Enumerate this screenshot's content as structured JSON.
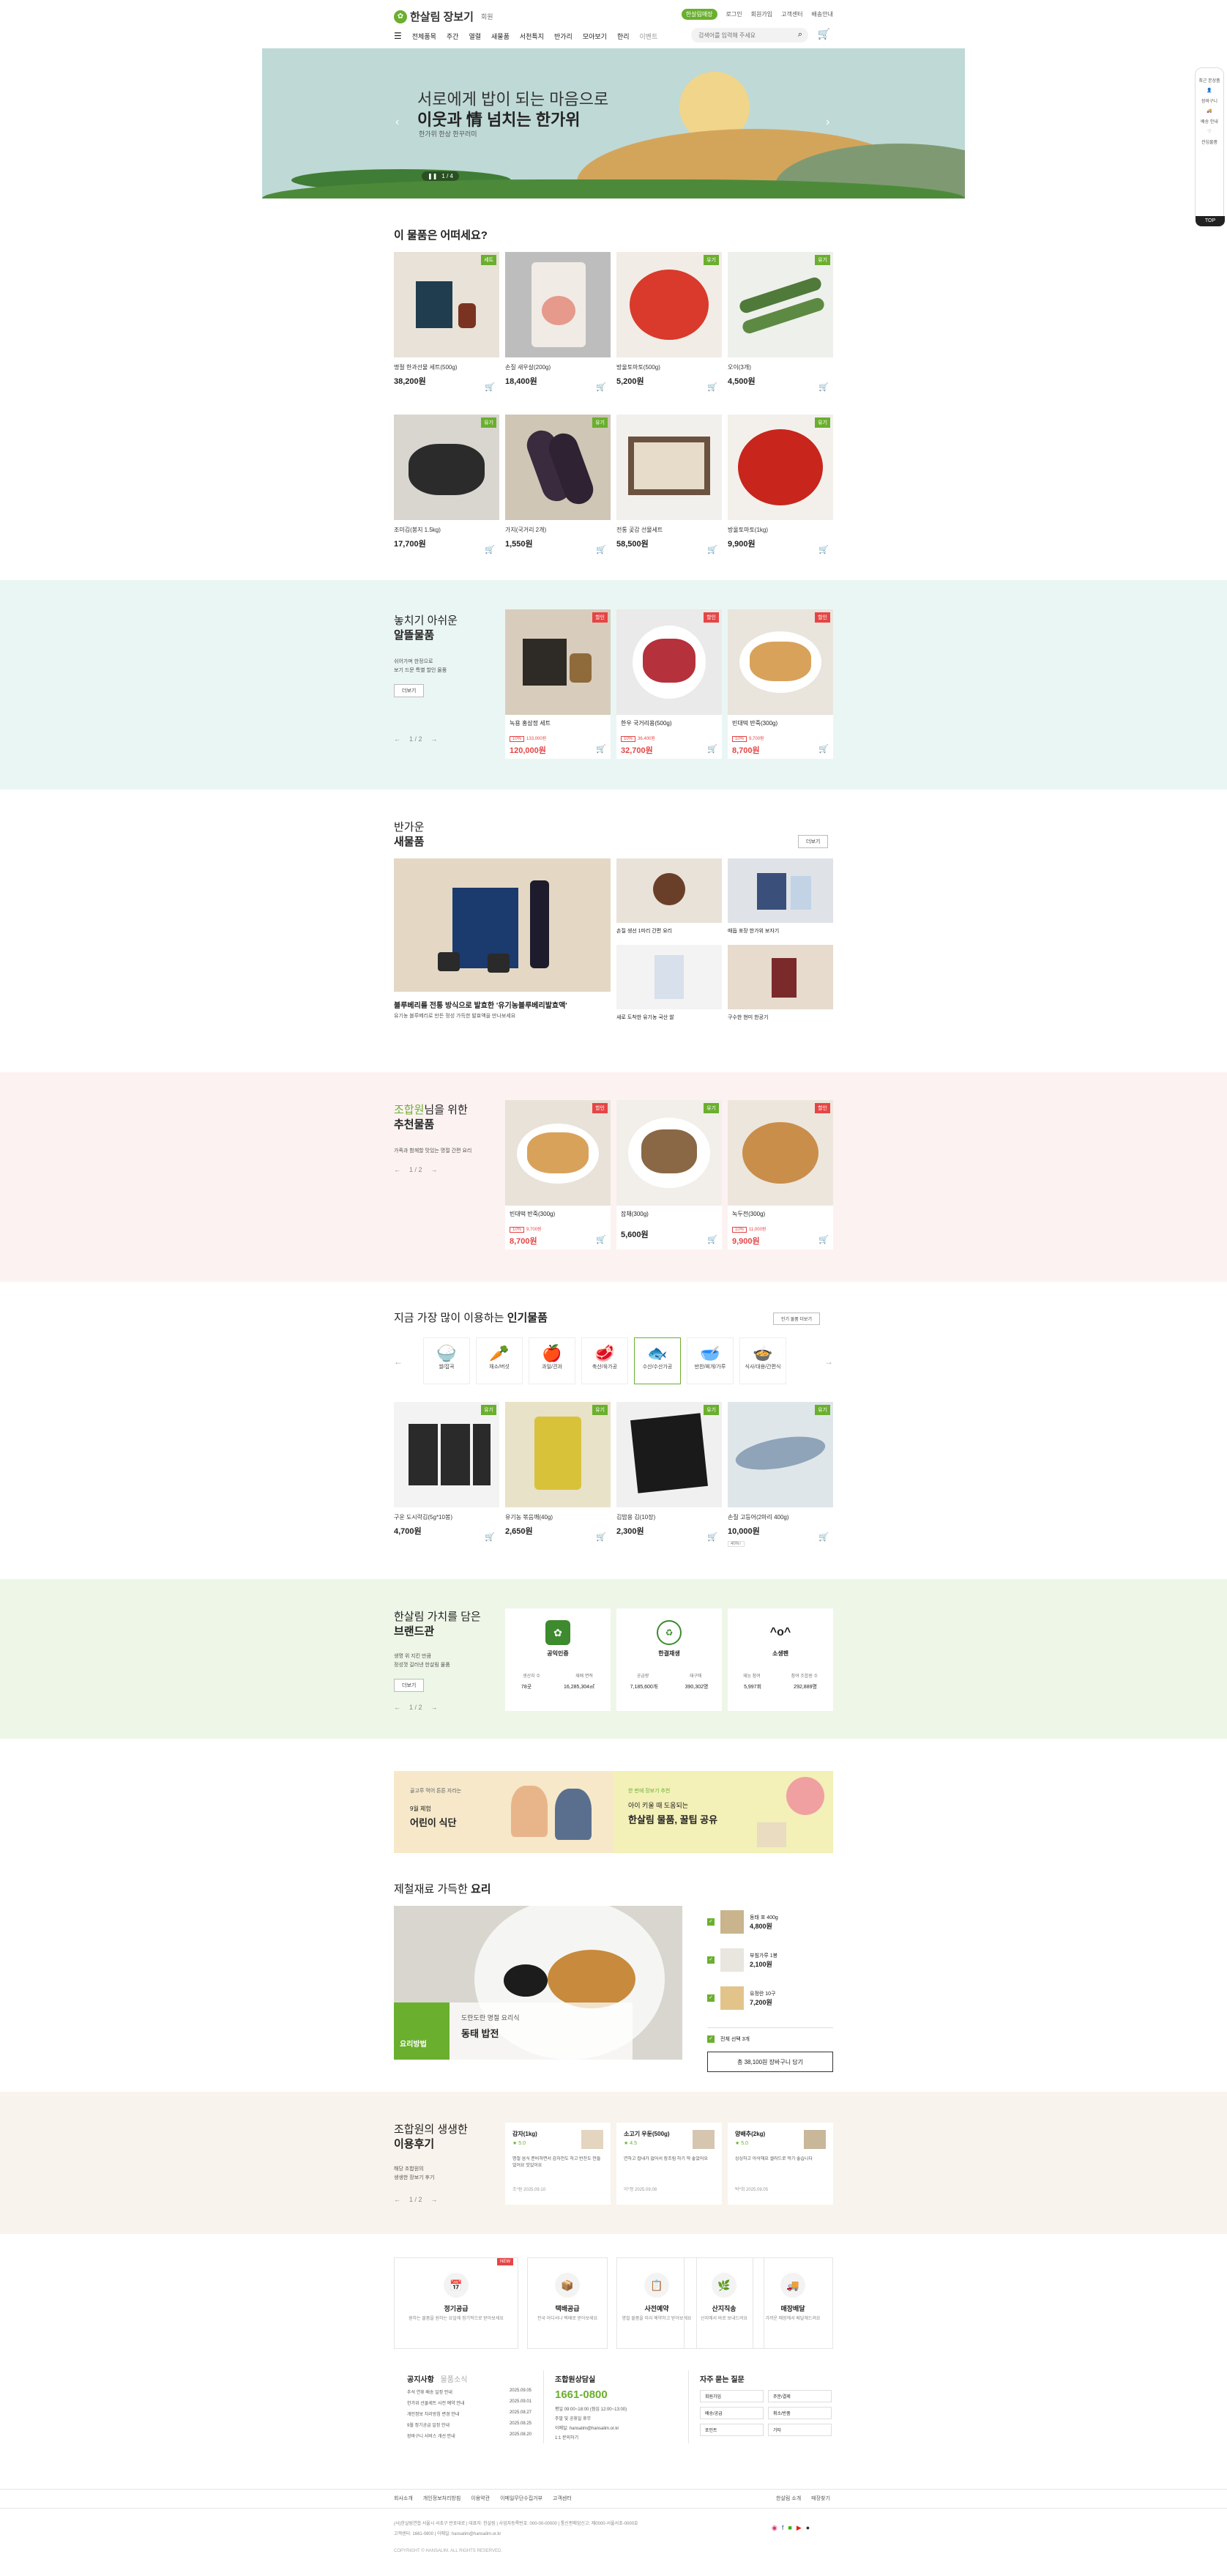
{
  "header": {
    "logo": "한살림 장보기",
    "logo_sub": "회원",
    "utility": [
      "한살림매장",
      "로그인",
      "회원가입",
      "고객센터",
      "배송안내"
    ],
    "utility_badge": "한살림매장",
    "nav": [
      "전체품목",
      "주간",
      "열렬",
      "새물품",
      "서천특지",
      "반가리",
      "모아보기",
      "한리"
    ],
    "nav_extra": "이벤트",
    "search_placeholder": "검색어를 입력해 주세요",
    "cart_count": "0"
  },
  "hero": {
    "line1": "서로에게 밥이 되는 마음으로",
    "line2": "이웃과 情 넘치는 한가위",
    "line3": "한가위 한상 한꾸러미",
    "pager": "1 / 4"
  },
  "quick": {
    "items": [
      "최근 본상품",
      "장바구니",
      "바로가기",
      "배송 안내",
      "관심물품",
      "바로보기"
    ],
    "top": "TOP"
  },
  "section_best": {
    "title": "이 물품은 어떠세요?",
    "items": [
      {
        "name": "명절 한과선물 세트(500g)",
        "price": "38,200원",
        "badge": "세트"
      },
      {
        "name": "손질 새우살(200g)",
        "price": "18,400원",
        "badge": ""
      },
      {
        "name": "방울토마토(500g)",
        "price": "5,200원",
        "badge": "유기"
      },
      {
        "name": "오이(3개)",
        "price": "4,500원",
        "badge": "유기"
      },
      {
        "name": "조미김(봉지 1.5kg)",
        "price": "17,700원",
        "badge": "유기"
      },
      {
        "name": "가지(국거리 2개)",
        "price": "1,550원",
        "badge": "유기"
      },
      {
        "name": "전통 곶감 선물세트",
        "price": "58,500원",
        "badge": ""
      },
      {
        "name": "방울토마토(1kg)",
        "price": "9,900원",
        "badge": "유기"
      }
    ]
  },
  "section_sale": {
    "title1": "놓치기 아쉬운",
    "title2": "알뜰물품",
    "desc1": "쉬어가며 한정으로",
    "desc2": "보기 드문 특별 할인 물품",
    "more": "더보기",
    "pager": "1 / 2",
    "items": [
      {
        "name": "녹용 홍삼정 세트",
        "discount": "10%",
        "old": "133,000원",
        "price": "120,000원",
        "badge": "할인"
      },
      {
        "name": "한우 국거리용(500g)",
        "discount": "10%",
        "old": "36,400원",
        "price": "32,700원",
        "badge": "할인"
      },
      {
        "name": "빈대떡 반죽(300g)",
        "discount": "10%",
        "old": "9,700원",
        "price": "8,700원",
        "badge": "할인"
      }
    ]
  },
  "section_new": {
    "title1": "반가운",
    "title2": "새물품",
    "more": "더보기",
    "main_caption": "블루베리를 전통 방식으로 발효한 '유기농블루베리발효액'",
    "main_sub": "유기농 블루베리로 만든 정성 가득한 발효액을 만나보세요",
    "items": [
      {
        "caption": "손질 생선 1마리 간편 요리"
      },
      {
        "caption": "매듭 포장 한가위 보자기"
      },
      {
        "caption": "새로 도착한 유기농 국산 쌀"
      },
      {
        "caption": "구수한 현미 한공기"
      }
    ]
  },
  "section_reco": {
    "title1": "조합원",
    "title1b": "님을 위한",
    "title2": "추천물품",
    "desc": "가족과 함께할 맛있는 명절 간편 요리",
    "pager": "1 / 2",
    "items": [
      {
        "name": "빈대떡 반죽(300g)",
        "discount": "10%",
        "old": "9,700원",
        "price": "8,700원",
        "badge": "할인"
      },
      {
        "name": "잡채(300g)",
        "price": "5,600원",
        "badge": "유기"
      },
      {
        "name": "녹두전(300g)",
        "discount": "10%",
        "old": "11,000원",
        "price": "9,900원",
        "badge": "할인"
      }
    ]
  },
  "section_popular": {
    "title_a": "지금 가장 많이 이용하는",
    "title_b": "인기물품",
    "more": "인기 물품 더보기",
    "categories": [
      "쌀/잡곡",
      "채소/버섯",
      "과일/견과",
      "축산/육가공",
      "수산/수산가공",
      "반찬/찌개/가루",
      "식사/대용/간편식"
    ],
    "items": [
      {
        "name": "구운 도시락김(5g*10봉)",
        "price": "4,700원",
        "badge": "유기"
      },
      {
        "name": "유기농 볶음깨(40g)",
        "price": "2,650원",
        "badge": "유기"
      },
      {
        "name": "김밥용 김(10장)",
        "price": "2,300원",
        "badge": "유기"
      },
      {
        "name": "손질 고등어(2마리 400g)",
        "price": "10,000원",
        "badge": "유기",
        "tag": "40%↑"
      }
    ]
  },
  "section_brand": {
    "title1": "한살림 가치를 담은",
    "title2": "브랜드관",
    "desc1": "생명 위 지킨 만큼",
    "desc2": "정성껏 길러낸 한살림 물품",
    "more": "더보기",
    "pager": "1 / 2",
    "cards": [
      {
        "title": "공익인증",
        "k1": "생산지 수",
        "v1": "78곳",
        "k2": "재배 면적",
        "v2": "16,285,304㎡"
      },
      {
        "title": "한결재생",
        "k1": "공급량",
        "v1": "7,185,600개",
        "k2": "재구매",
        "v2": "390,302명"
      },
      {
        "title": "소생팬",
        "k1": "재능 참여",
        "v1": "5,997회",
        "k2": "참여 조합원 수",
        "v2": "292,889명"
      }
    ]
  },
  "banner": {
    "left_sub1": "골고루 먹어 튼튼 자라는",
    "left_sub2": "9월 체험",
    "left_title": "어린이 식단",
    "right_sub1": "한 번에 장보기 추천",
    "right_sub2": "아이 키울 때 도움되는",
    "right_title": "한살림 물품, 꿀팁 공유"
  },
  "section_recipe": {
    "title_a": "제철재료 가득한",
    "title_b": "요리",
    "label": "요리방법",
    "recipe_sub": "도란도란 명절 요리식",
    "recipe_title": "동태 밥전",
    "items": [
      {
        "name": "동태 포 400g",
        "price": "4,800원"
      },
      {
        "name": "부침가루 1봉",
        "price": "2,100원"
      },
      {
        "name": "유정란 10구",
        "price": "7,200원"
      }
    ],
    "select_all": "전체 선택 3개",
    "add_cart": "총 38,100원 장바구니 담기"
  },
  "section_review": {
    "title1": "조합원의 생생한",
    "title2": "이용후기",
    "desc1": "해당 조합원의",
    "desc2": "생생한 장보기 후기",
    "pager": "1 / 2",
    "cards": [
      {
        "name": "감자(1kg)",
        "rating": "5.0",
        "text": "명절 음식 준비하면서 감자전도 하고 반찬도 만들었어요 맛있어요",
        "author": "조*원 2025.09.10"
      },
      {
        "name": "소고기 우둔(500g)",
        "rating": "4.5",
        "text": "연하고 잡내가 없어서 장조림 하기 딱 좋았어요",
        "author": "이*정 2025.09.08"
      },
      {
        "name": "양배추(2kg)",
        "rating": "5.0",
        "text": "싱싱하고 아삭해요 샐러드로 먹기 좋습니다",
        "author": "박*희 2025.09.05"
      }
    ]
  },
  "services": [
    {
      "title": "정기공급",
      "desc": "원하는 물품을 원하는 요일에 정기적으로 받아보세요",
      "badge": "NEW"
    },
    {
      "title": "택배공급",
      "desc": "전국 어디서나 택배로 받아보세요"
    },
    {
      "title": "사전예약",
      "desc": "명절 물품을 미리 예약하고 받아보세요"
    },
    {
      "title": "산지직송",
      "desc": "산지에서 바로 보내드려요"
    },
    {
      "title": "매장배달",
      "desc": "가까운 매장에서 배달해드려요"
    }
  ],
  "notice": {
    "title": "공지사항",
    "tab2": "물품소식",
    "rows": [
      {
        "t": "추석 연휴 배송 일정 안내",
        "d": "2025.09.05"
      },
      {
        "t": "한가위 선물세트 사전 예약 안내",
        "d": "2025.09.01"
      },
      {
        "t": "개인정보 처리방침 변경 안내",
        "d": "2025.08.27"
      },
      {
        "t": "9월 정기공급 일정 안내",
        "d": "2025.08.25"
      },
      {
        "t": "장바구니 서비스 개선 안내",
        "d": "2025.08.20"
      }
    ]
  },
  "cs": {
    "title": "조합원상담실",
    "phone": "1661-0800",
    "lines": [
      "평일 09:00~18:00 (점심 12:00~13:00)",
      "주말 및 공휴일 휴무",
      "이메일: hansalim@hansalim.or.kr",
      "1:1 문의하기"
    ]
  },
  "faq": {
    "title": "자주 묻는 질문",
    "items": [
      "회원가입",
      "주문/결제",
      "배송/공급",
      "취소/반품",
      "포인트",
      "기타"
    ]
  },
  "footer": {
    "links": [
      "회사소개",
      "개인정보처리방침",
      "이용약관",
      "이메일무단수집거부",
      "고객센터"
    ],
    "right_links": [
      "한살림 소개",
      "매장찾기"
    ],
    "info1": "(사)한살림연합 서울시 서초구 반포대로 | 대표자: 한살림 | 사업자등록번호: 000-00-00000 | 통신판매업신고: 제0000-서울서초-0000호",
    "info2": "고객센터: 1661-0800 | 이메일: hansalim@hansalim.or.kr",
    "copyright": "COPYRIGHT © HANSALIM. ALL RIGHTS RESERVED."
  }
}
